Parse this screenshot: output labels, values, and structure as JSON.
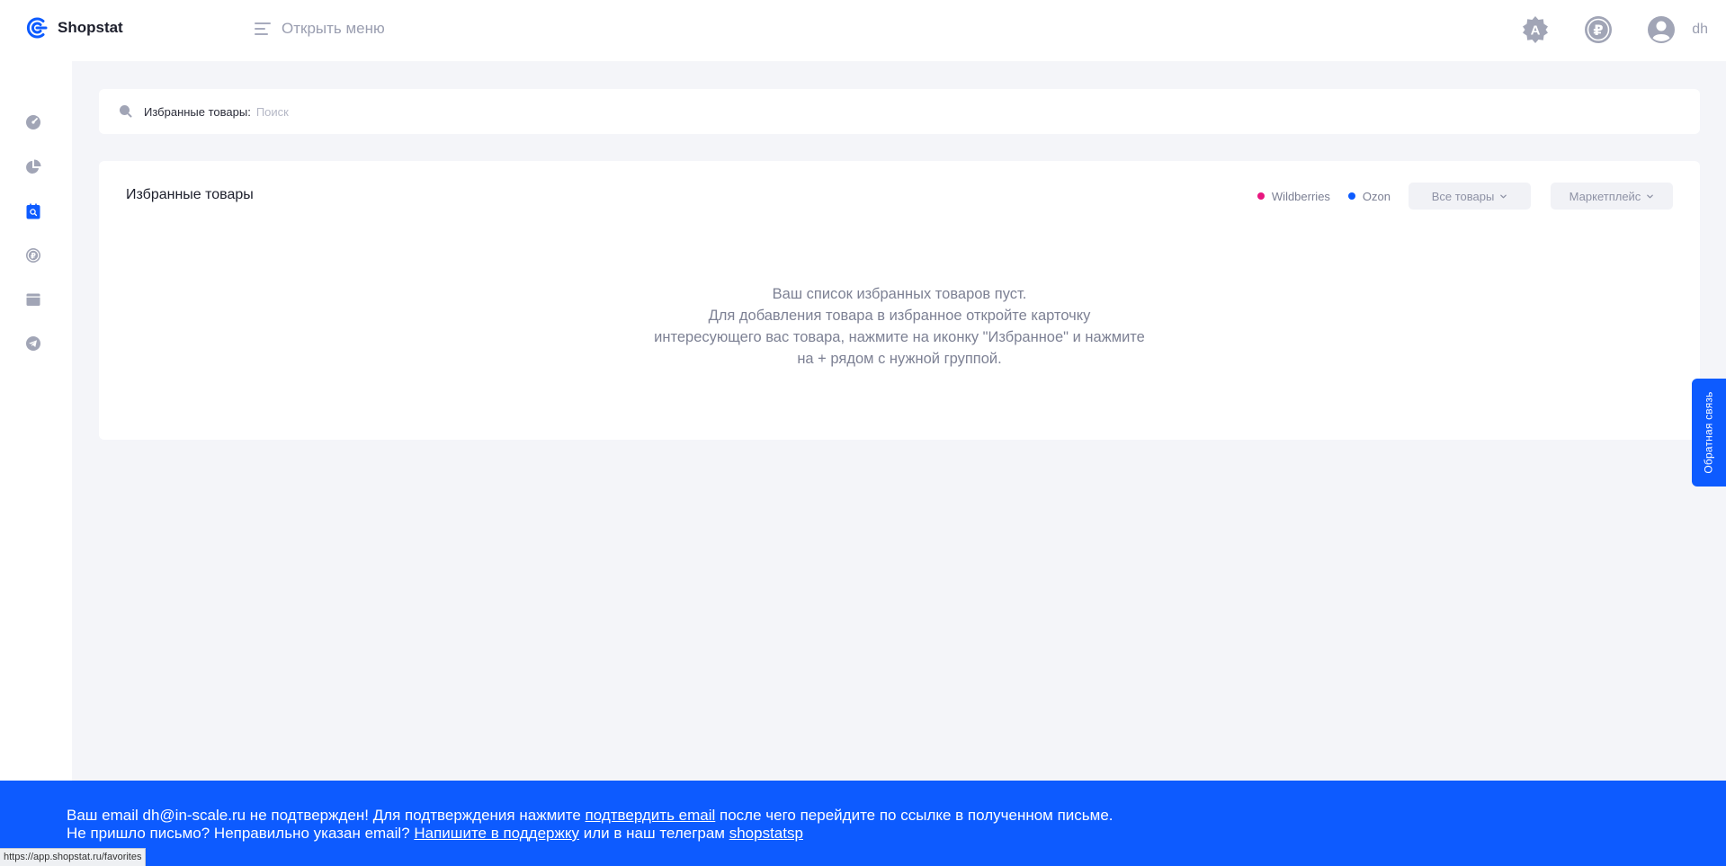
{
  "app": {
    "name": "Shopstat"
  },
  "header": {
    "menu_label": "Открыть меню",
    "user_name": "dh",
    "icons": [
      "premium-badge-icon",
      "ruble-coin-icon",
      "user-avatar-icon"
    ]
  },
  "sidebar": {
    "items": [
      {
        "name": "dashboard",
        "icon": "gauge-icon",
        "active": false
      },
      {
        "name": "analytics",
        "icon": "pie-chart-icon",
        "active": false
      },
      {
        "name": "favorites",
        "icon": "favorites-search-icon",
        "active": true
      },
      {
        "name": "finance",
        "icon": "ruble-icon",
        "active": false
      },
      {
        "name": "reports",
        "icon": "calendar-icon",
        "active": false
      },
      {
        "name": "telegram",
        "icon": "telegram-icon",
        "active": false
      }
    ]
  },
  "search": {
    "prefix": "Избранные товары:",
    "placeholder": "Поиск",
    "value": ""
  },
  "favorites": {
    "title": "Избранные товары",
    "legend": [
      {
        "label": "Wildberries",
        "color": "#e8177f"
      },
      {
        "label": "Ozon",
        "color": "#0d5bff"
      }
    ],
    "filter_all": "Все товары",
    "filter_marketplace": "Маркетплейс",
    "empty_lines": [
      "Ваш список избранных товаров пуст.",
      "Для добавления товара в избранное откройте карточку",
      "интересующего вас товара, нажмите на иконку \"Избранное\" и нажмите",
      "на + рядом с нужной группой."
    ]
  },
  "feedback": {
    "label": "Обратная связь"
  },
  "banner": {
    "line1_pre": "Ваш email dh@in-scale.ru не подтвержден! Для подтверждения нажмите ",
    "line1_link": "подтвердить email",
    "line1_post": " после чего перейдите по ссылке в полученном письме.",
    "line2_pre": "Не пришло письмо? Неправильно указан email? ",
    "line2_link1": "Напишите в поддержку",
    "line2_mid": " или в наш телеграм ",
    "line2_link2": "shopstatsp"
  },
  "status_bar": {
    "url": "https://app.shopstat.ru/favorites"
  },
  "colors": {
    "accent": "#0d5bff",
    "wildberries": "#e8177f",
    "ozon": "#0d5bff",
    "icon_gray": "#a1a5b6"
  }
}
